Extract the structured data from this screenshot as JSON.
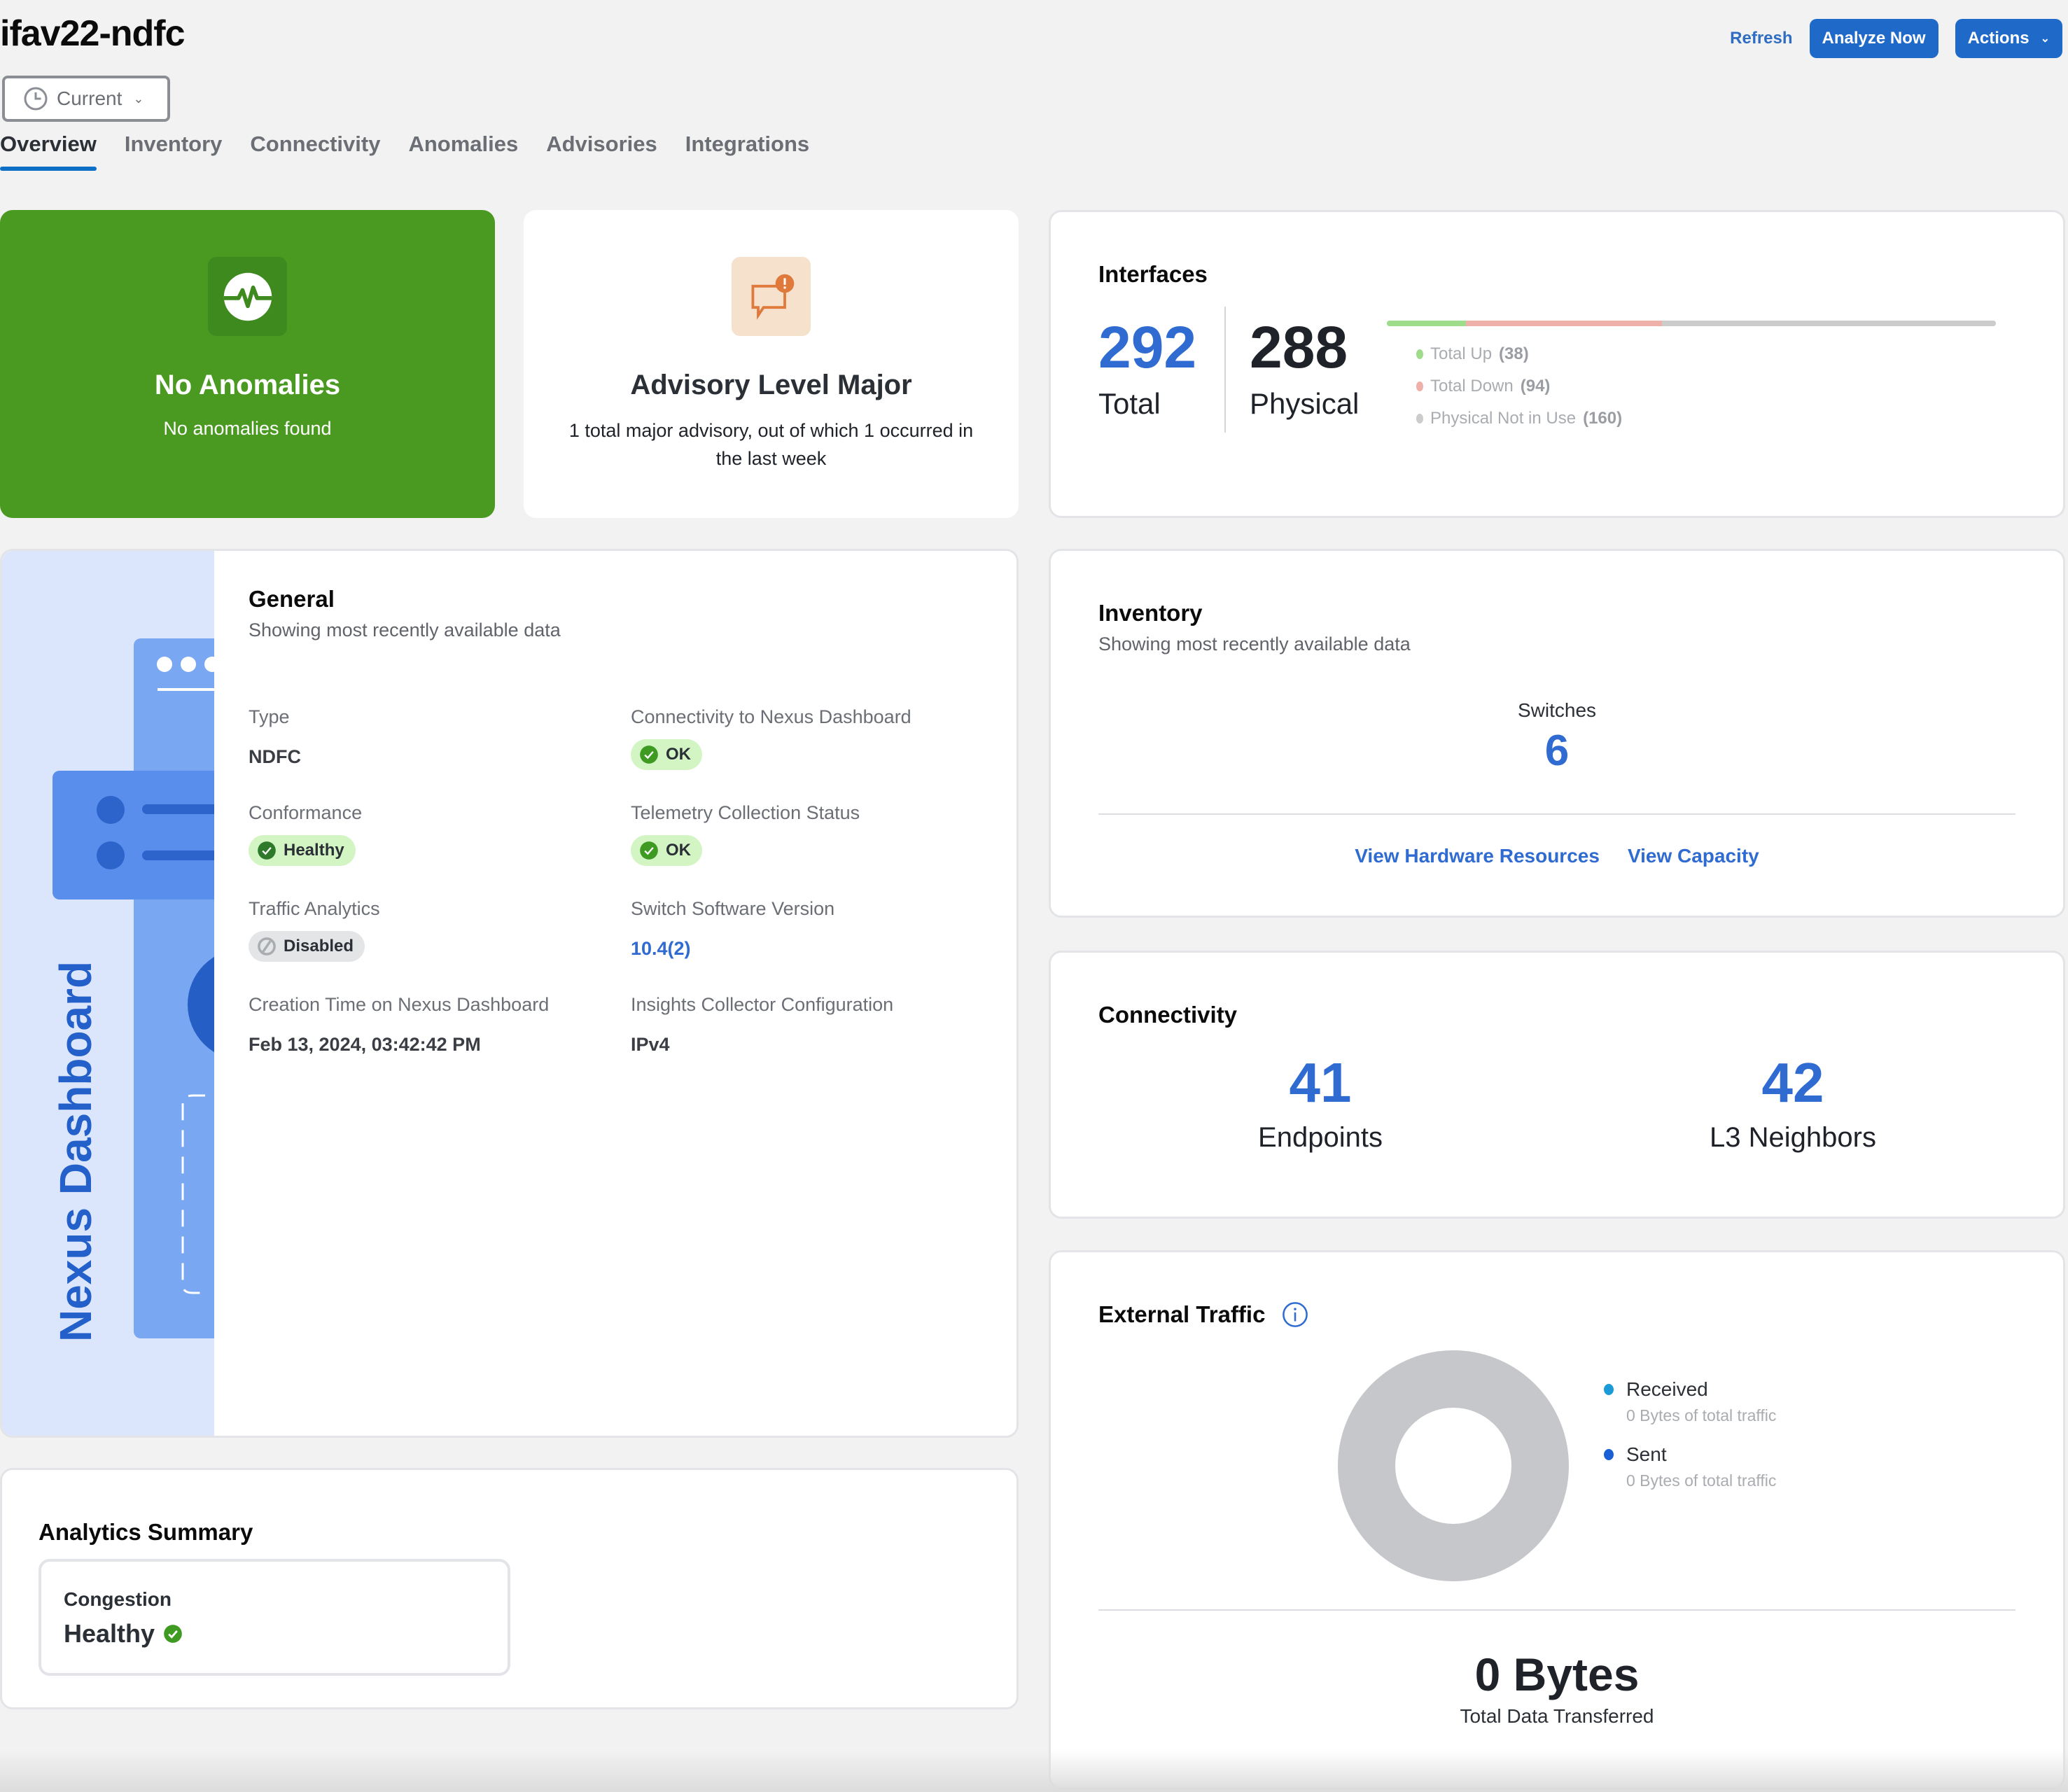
{
  "header": {
    "title": "ifav22-ndfc",
    "time_selector": {
      "value": "Current",
      "icon": "clock-icon"
    },
    "actions": {
      "refresh_label": "Refresh",
      "analyze_label": "Analyze Now",
      "actions_label": "Actions"
    }
  },
  "tabs": [
    {
      "label": "Overview",
      "active": true
    },
    {
      "label": "Inventory",
      "active": false
    },
    {
      "label": "Connectivity",
      "active": false
    },
    {
      "label": "Anomalies",
      "active": false
    },
    {
      "label": "Advisories",
      "active": false
    },
    {
      "label": "Integrations",
      "active": false
    }
  ],
  "anomalies_card": {
    "icon": "heartbeat-icon",
    "title": "No Anomalies",
    "subtitle": "No anomalies found",
    "color": "#4a9a22"
  },
  "advisory_card": {
    "icon": "chat-alert-icon",
    "title": "Advisory Level Major",
    "subtitle": "1 total major advisory, out of which 1 occurred in the last week",
    "color": "#e07a3c"
  },
  "interfaces": {
    "title": "Interfaces",
    "total": {
      "value": "292",
      "label": "Total"
    },
    "physical": {
      "value": "288",
      "label": "Physical"
    },
    "breakdown": [
      {
        "label": "Total Up",
        "count": 38,
        "count_text": "(38)",
        "color": "#9edb8a"
      },
      {
        "label": "Total Down",
        "count": 94,
        "count_text": "(94)",
        "color": "#eeb0a8"
      },
      {
        "label": "Physical Not in Use",
        "count": 160,
        "count_text": "(160)",
        "color": "#cccccc"
      }
    ]
  },
  "general": {
    "illustration_text": "Nexus Dashboard",
    "title": "General",
    "subtitle": "Showing most recently available data",
    "fields": {
      "type": {
        "label": "Type",
        "value": "NDFC"
      },
      "connectivity": {
        "label": "Connectivity to Nexus Dashboard",
        "value": "OK",
        "status": "ok"
      },
      "conformance": {
        "label": "Conformance",
        "value": "Healthy",
        "status": "ok"
      },
      "telemetry": {
        "label": "Telemetry Collection Status",
        "value": "OK",
        "status": "ok"
      },
      "traffic_analytics": {
        "label": "Traffic Analytics",
        "value": "Disabled",
        "status": "disabled"
      },
      "software_version": {
        "label": "Switch Software Version",
        "value": "10.4(2)"
      },
      "creation_time": {
        "label": "Creation Time on Nexus Dashboard",
        "value": "Feb 13, 2024, 03:42:42 PM"
      },
      "collector_config": {
        "label": "Insights Collector Configuration",
        "value": "IPv4"
      }
    }
  },
  "inventory": {
    "title": "Inventory",
    "subtitle": "Showing most recently available data",
    "switches_label": "Switches",
    "switches_value": "6",
    "links": [
      "View Hardware Resources",
      "View Capacity"
    ]
  },
  "connectivity": {
    "title": "Connectivity",
    "stats": [
      {
        "value": "41",
        "label": "Endpoints"
      },
      {
        "value": "42",
        "label": "L3 Neighbors"
      }
    ]
  },
  "external_traffic": {
    "title": "External Traffic",
    "legend": [
      {
        "name": "Received",
        "detail": "0 Bytes of total traffic",
        "color": "#1a9bd7"
      },
      {
        "name": "Sent",
        "detail": "0 Bytes of total traffic",
        "color": "#1a5fd6"
      }
    ],
    "total_value": "0 Bytes",
    "total_label": "Total Data Transferred",
    "empty_color": "#c6c7ca"
  },
  "analytics_summary": {
    "title": "Analytics Summary",
    "items": [
      {
        "label": "Congestion",
        "value": "Healthy",
        "status": "ok"
      }
    ]
  },
  "chart_data": {
    "type": "pie",
    "title": "External Traffic",
    "categories": [
      "Received",
      "Sent"
    ],
    "values": [
      0,
      0
    ],
    "unit": "Bytes",
    "donut": true,
    "legend": "right"
  }
}
